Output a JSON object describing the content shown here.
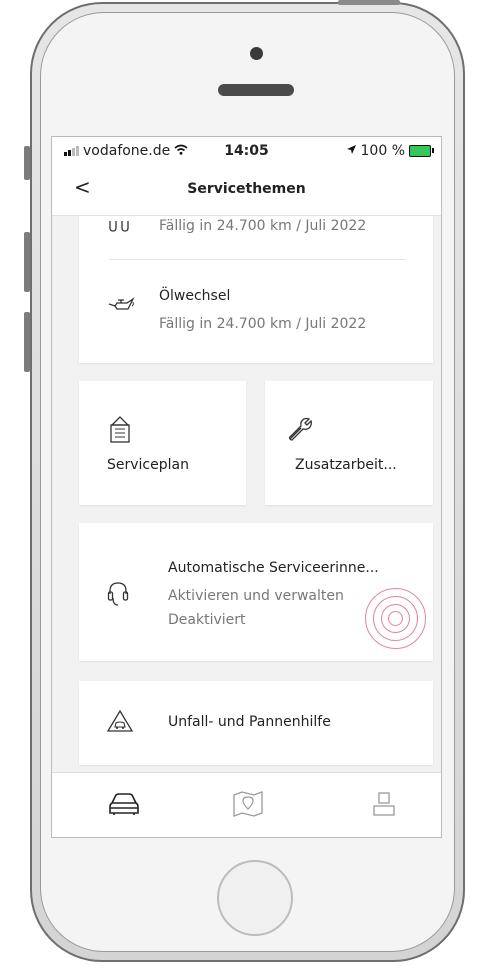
{
  "status": {
    "carrier": "vodafone.de",
    "time": "14:05",
    "battery": "100 %"
  },
  "nav": {
    "back": "<",
    "title": "Servicethemen"
  },
  "service_items": [
    {
      "title": "",
      "due": "Fällig in 24.700 km / Juli 2022"
    },
    {
      "title": "Ölwechsel",
      "due": "Fällig in 24.700 km / Juli 2022"
    }
  ],
  "tiles": {
    "serviceplan": "Serviceplan",
    "zusatz": "Zusatzarbeit..."
  },
  "reminder": {
    "title": "Automatische Serviceerinne...",
    "line1": "Aktivieren und verwalten",
    "line2": "Deaktiviert"
  },
  "help": {
    "label": "Unfall- und Pannenhilfe"
  },
  "tabs": [
    "car-icon",
    "map-icon",
    "profile-icon"
  ],
  "colors": {
    "accent_ring": "#e8839a",
    "battery": "#35c759"
  }
}
